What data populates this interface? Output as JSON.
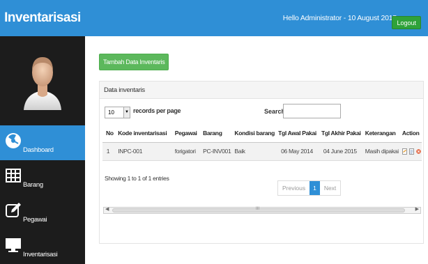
{
  "header": {
    "brand": "Inventarisasi",
    "greeting": "Hello Administrator - 10 August 2015",
    "logout_label": "Logout",
    "colors": {
      "bar": "#2f8fd6",
      "logout": "#2fa23a"
    }
  },
  "sidebar": {
    "avatar_icon": "user-avatar",
    "items": [
      {
        "label": "Dashboard",
        "icon": "dashboard-icon",
        "active": true
      },
      {
        "label": "Barang",
        "icon": "grid-icon",
        "active": false
      },
      {
        "label": "Pegawai",
        "icon": "edit-icon",
        "active": false
      },
      {
        "label": "Inventarisasi",
        "icon": "monitor-icon",
        "active": false
      }
    ]
  },
  "main": {
    "add_button": "Tambah Data Inventaris",
    "panel_title": "Data inventaris",
    "length_value": "10",
    "length_label": "records per page",
    "search_label": "Search:",
    "search_value": "",
    "table": {
      "headers": [
        "No",
        "Kode inventarisasi",
        "Pegawai",
        "Barang",
        "Kondisi barang",
        "Tgl Awal Pakai",
        "Tgl Akhir Pakai",
        "Keterangan",
        "Action"
      ],
      "rows": [
        [
          "1",
          "INPC-001",
          "forigatori",
          "PC-INV001",
          "Baik",
          "06 May 2014",
          "04 June 2015",
          "Masih dipakai"
        ]
      ]
    },
    "info": "Showing 1 to 1 of 1 entries",
    "pagination": {
      "previous": "Previous",
      "current": "1",
      "next": "Next"
    },
    "scroll_marker": "III"
  }
}
